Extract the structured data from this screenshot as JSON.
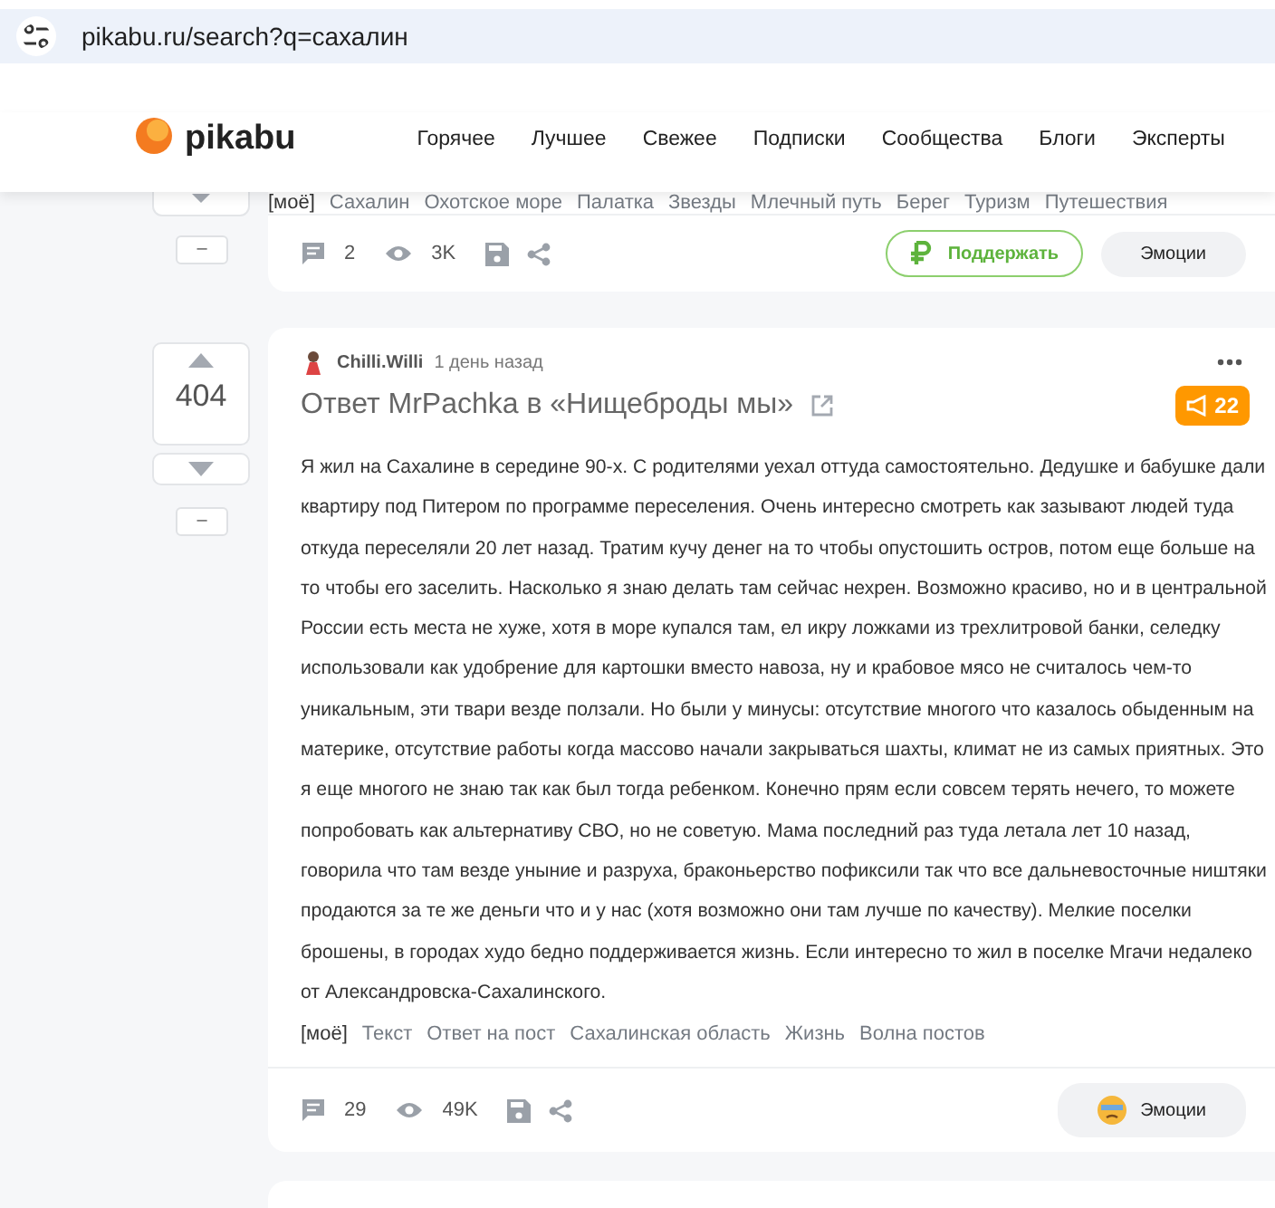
{
  "address_bar": {
    "url": "pikabu.ru/search?q=сахалин"
  },
  "header": {
    "logo": "pikabu",
    "nav": [
      "Горячее",
      "Лучшее",
      "Свежее",
      "Подписки",
      "Сообщества",
      "Блоги",
      "Эксперты"
    ]
  },
  "previous_post": {
    "tags": [
      "[моё]",
      "Сахалин",
      "Охотское море",
      "Палатка",
      "Звезды",
      "Млечный путь",
      "Берег",
      "Туризм",
      "Путешествия"
    ],
    "comments": "2",
    "views": "3K",
    "donate": "Поддержать",
    "emotions": "Эмоции",
    "collapse": "–"
  },
  "post": {
    "rating": "404",
    "collapse": "–",
    "author": "Chilli.Willi",
    "time": "1 день назад",
    "title": "Ответ MrPachka в «Нищеброды мы»",
    "badge": "22",
    "body": "Я жил на Сахалине в середине 90-х. С родителями уехал оттуда самостоятельно. Дедушке и бабушке дали квартиру под Питером по программе переселения. Очень интересно смотреть как зазывают людей туда откуда переселяли 20 лет назад. Тратим кучу денег на то чтобы опустошить остров, потом еще больше на то чтобы его заселить. Насколько я знаю делать там сейчас нехрен. Возможно красиво, но и в центральной России есть места не хуже, хотя в море купался там, ел икру ложками из трехлитровой банки, селедку использовали как удобрение для картошки вместо навоза, ну и крабовое мясо не считалось чем-то уникальным, эти твари везде ползали. Но были у минусы: отсутствие многого что казалось обыденным на материке, отсутствие работы когда массово начали закрываться шахты, климат не из самых приятных. Это я еще многого не знаю так как был тогда ребенком. Конечно прям если совсем терять нечего, то можете попробовать как альтернативу СВО, но не советую. Мама последний раз туда летала лет 10 назад, говорила что там везде уныние и разруха, браконьерство пофиксили так что все дальневосточные ништяки продаются за те же деньги что и у нас (хотя возможно они там лучше по качеству). Мелкие поселки брошены, в городах худо бедно поддерживается жизнь. Если интересно то жил в поселке Мгачи недалеко от Александровска-Сахалинского.",
    "tags": [
      "[моё]",
      "Текст",
      "Ответ на пост",
      "Сахалинская область",
      "Жизнь",
      "Волна постов"
    ],
    "comments": "29",
    "views": "49K",
    "emotions": "Эмоции"
  }
}
